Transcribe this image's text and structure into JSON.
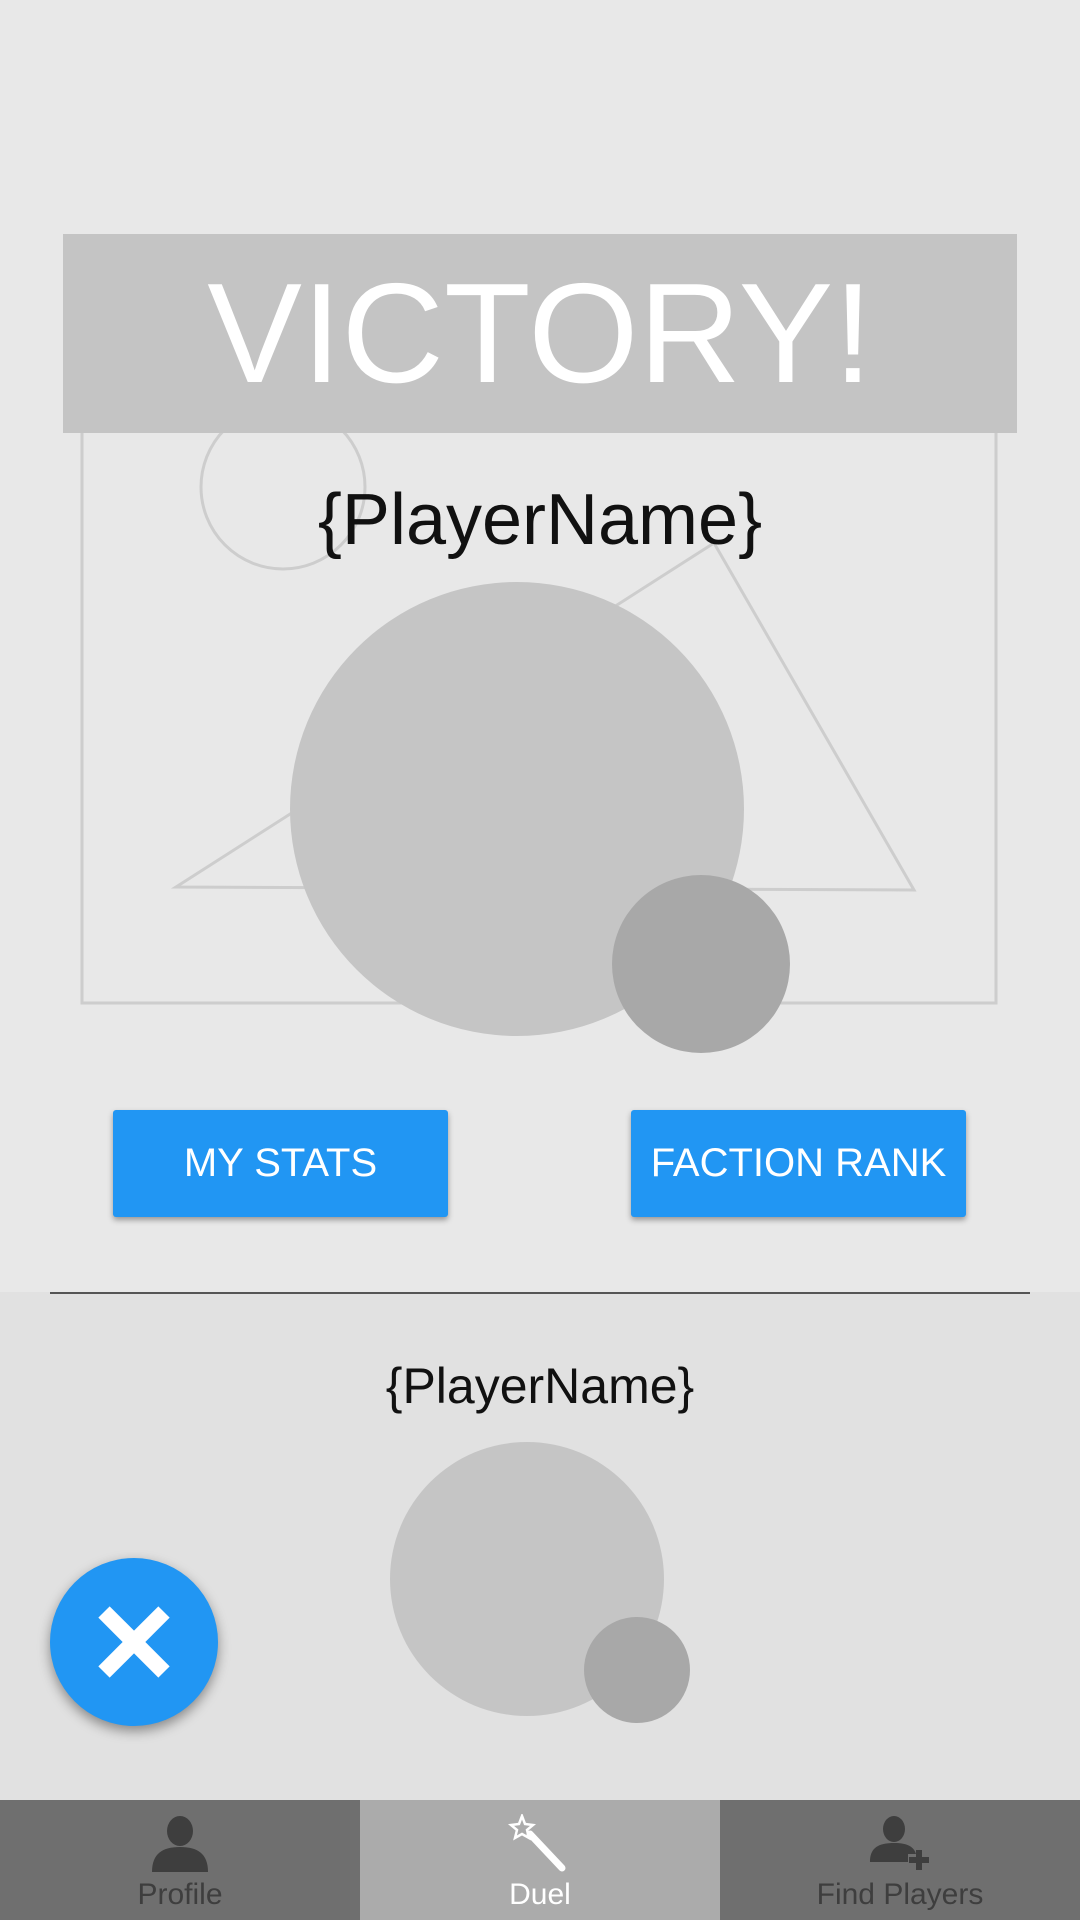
{
  "result": {
    "title": "VICTORY!",
    "winner_name": "{PlayerName}"
  },
  "actions": {
    "stats_label": "MY STATS",
    "rank_label": "FACTION RANK"
  },
  "opponent": {
    "name": "{PlayerName}"
  },
  "fab": {
    "icon": "close-icon"
  },
  "tabs": [
    {
      "label": "Profile",
      "icon": "person-icon",
      "active": false
    },
    {
      "label": "Duel",
      "icon": "magic-wand-icon",
      "active": true
    },
    {
      "label": "Find Players",
      "icon": "add-person-icon",
      "active": false
    }
  ],
  "colors": {
    "accent": "#2196f3",
    "background": "#e8e8e8",
    "banner": "#c4c4c4",
    "tab_inactive": "#6f6f6f",
    "tab_active": "#ababab"
  }
}
